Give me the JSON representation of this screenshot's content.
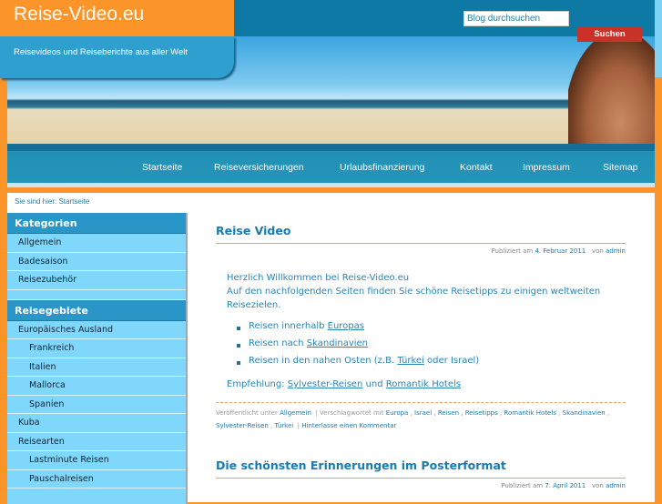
{
  "header": {
    "site_title": "Reise-Video.eu",
    "tagline": "Reisevideos und Reiseberichte aus aller Welt",
    "search_placeholder": "Blog durchsuchen",
    "search_button": "Suchen"
  },
  "nav": [
    "Startseite",
    "Reiseversicherungen",
    "Urlaubsfinanzierung",
    "Kontakt",
    "Impressum",
    "Sitemap"
  ],
  "breadcrumb": "Sie sind hier: Startseite",
  "sidebar": {
    "kategorien_title": "Kategorien",
    "kategorien": [
      "Allgemein",
      "Badesaison",
      "Reisezubehör"
    ],
    "reisegebiete_title": "Reisegebiete",
    "reisegebiete": [
      {
        "label": "Europäisches Ausland",
        "sub": false
      },
      {
        "label": "Frankreich",
        "sub": true
      },
      {
        "label": "Italien",
        "sub": true
      },
      {
        "label": "Mallorca",
        "sub": true
      },
      {
        "label": "Spanien",
        "sub": true
      },
      {
        "label": "Kuba",
        "sub": false
      },
      {
        "label": "Reisearten",
        "sub": false
      },
      {
        "label": "Lastminute Reisen",
        "sub": true
      },
      {
        "label": "Pauschalreisen",
        "sub": true
      }
    ]
  },
  "posts": [
    {
      "title": "Reise Video",
      "published_prefix": "Publiziert am",
      "date": "4. Februar 2011",
      "by": "von",
      "author": "admin",
      "intro1": "Herzlich Willkommen bei Reise-Video.eu",
      "intro2": "Auf den nachfolgenden Seiten finden Sie schöne Reisetipps zu einigen weltweiten Reisezielen.",
      "list": [
        {
          "pre": "Reisen innerhalb ",
          "link": "Europas",
          "post": ""
        },
        {
          "pre": "Reisen nach ",
          "link": "Skandinavien",
          "post": ""
        },
        {
          "pre": "Reisen in den nahen Osten (z.B. ",
          "link": "Türkei",
          "post": " oder Israel)"
        }
      ],
      "empfehlung": "Empfehlung: ",
      "link1": "Sylvester-Reisen",
      "und": " und ",
      "link2": "Romantik Hotels",
      "filed_under": "Veröffentlicht unter",
      "category": "Allgemein",
      "tagged": "| Verschlagwortet mit",
      "tags": [
        "Europa",
        "Israel",
        "Reisen",
        "Reisetipps",
        "Romantik Hotels",
        "Skandinavien",
        "Sylvester-Reisen",
        "Türkei"
      ],
      "comment": "Hinterlasse einen Kommentar"
    },
    {
      "title": "Die schönsten Erinnerungen im Posterformat",
      "published_prefix": "Publiziert am",
      "date": "7. April 2011",
      "by": "von",
      "author": "admin"
    }
  ]
}
